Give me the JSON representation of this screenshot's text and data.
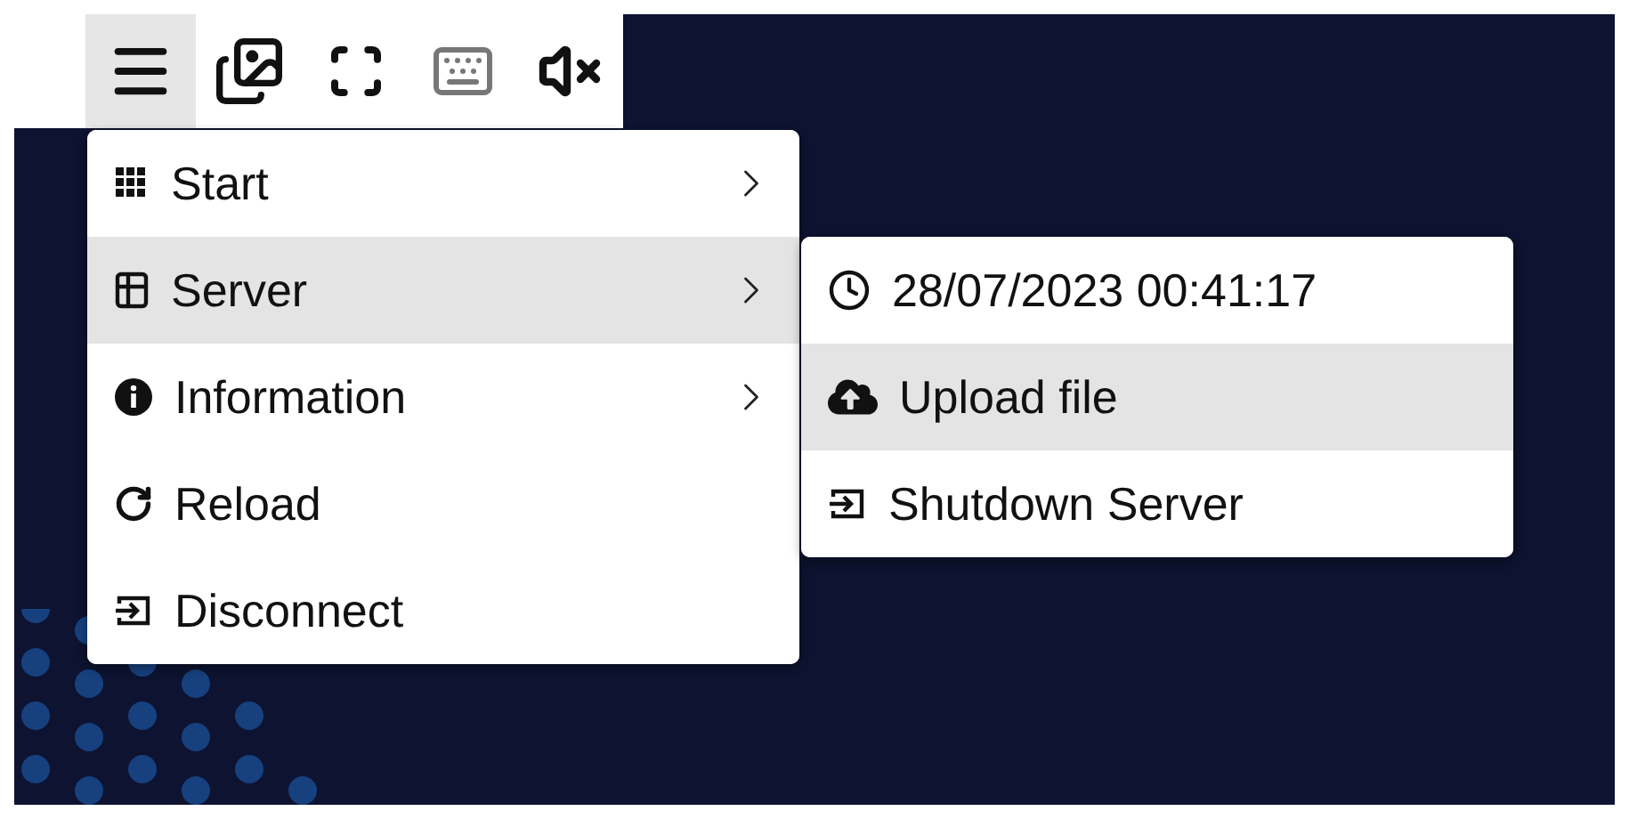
{
  "toolbar": [
    {
      "kind": "menu",
      "selected": true,
      "disabled": false
    },
    {
      "kind": "gallery",
      "selected": false,
      "disabled": false
    },
    {
      "kind": "fullscreen",
      "selected": false,
      "disabled": false
    },
    {
      "kind": "keyboard",
      "selected": false,
      "disabled": true
    },
    {
      "kind": "mute",
      "selected": false,
      "disabled": false
    }
  ],
  "menu": {
    "items": [
      {
        "label": "Start",
        "kind": "grid",
        "has_submenu": true,
        "selected": false
      },
      {
        "label": "Server",
        "kind": "server",
        "has_submenu": true,
        "selected": true
      },
      {
        "label": "Information",
        "kind": "info",
        "has_submenu": true,
        "selected": false
      },
      {
        "label": "Reload",
        "kind": "reload",
        "has_submenu": false,
        "selected": false
      },
      {
        "label": "Disconnect",
        "kind": "exit",
        "has_submenu": false,
        "selected": false
      }
    ]
  },
  "submenu": {
    "items": [
      {
        "label": "28/07/2023 00:41:17",
        "kind": "clock",
        "selected": false
      },
      {
        "label": "Upload file",
        "kind": "upload",
        "selected": true
      },
      {
        "label": "Shutdown Server",
        "kind": "exit",
        "selected": false
      }
    ]
  }
}
